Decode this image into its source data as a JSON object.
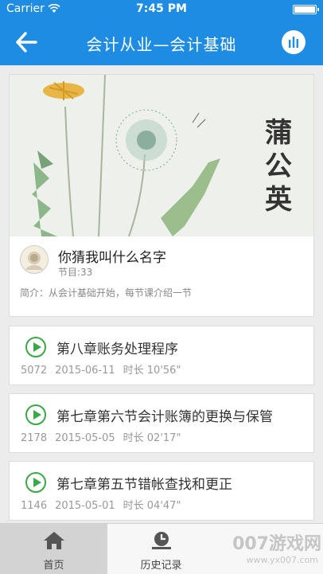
{
  "status_bar": {
    "carrier": "Carrier",
    "time": "7:45 PM"
  },
  "nav": {
    "title": "会计从业—会计基础",
    "back_icon": "back-arrow-icon",
    "menu_icon": "equalizer-icon"
  },
  "podcast": {
    "cover_text": "蒲公英",
    "name": "你猜我叫什么名字",
    "episodes": "节目:33",
    "intro": "简介：从会计基础开始，每节课介绍一节"
  },
  "episodes": [
    {
      "title": "第八章账务处理程序",
      "plays": "5072",
      "date": "2015-06-11",
      "duration": "时长 10'56\""
    },
    {
      "title": "第七章第六节会计账簿的更换与保管",
      "plays": "2178",
      "date": "2015-05-05",
      "duration": "时长 02'17\""
    },
    {
      "title": "第七章第五节错帐查找和更正",
      "plays": "1146",
      "date": "2015-05-01",
      "duration": "时长 04'47\""
    }
  ],
  "tabs": [
    {
      "label": "首页",
      "icon": "home-icon"
    },
    {
      "label": "历史记录",
      "icon": "history-icon"
    },
    {
      "label": "",
      "icon": ""
    }
  ],
  "watermark": {
    "text": "007游戏网",
    "url": "www.yx007.com"
  },
  "colors": {
    "accent": "#1f8ce3",
    "play": "#3aa847"
  }
}
